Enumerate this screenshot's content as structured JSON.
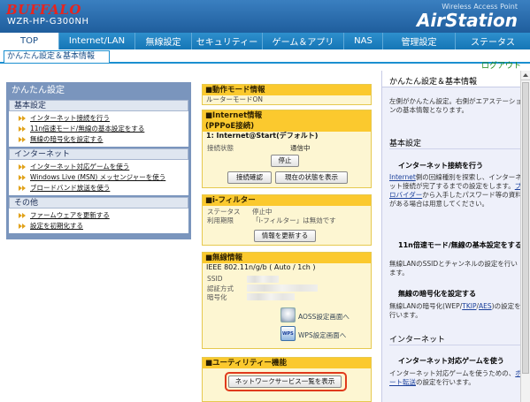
{
  "header": {
    "logo": "BUFFALO",
    "model": "WZR-HP-G300NH",
    "subtitle": "Wireless Access Point",
    "brand": "AirStation"
  },
  "nav": {
    "tabs": [
      {
        "label": "TOP",
        "active": true
      },
      {
        "label": "Internet/LAN",
        "active": false
      },
      {
        "label": "無線設定",
        "active": false
      },
      {
        "label": "セキュリティー",
        "active": false
      },
      {
        "label": "ゲーム＆アプリ",
        "active": false
      },
      {
        "label": "NAS",
        "active": false
      },
      {
        "label": "管理設定",
        "active": false
      },
      {
        "label": "ステータス",
        "active": false
      }
    ],
    "breadcrumb": "かんたん設定＆基本情報",
    "logout": "ログアウト"
  },
  "quick": {
    "title": "かんたん設定",
    "sections": [
      {
        "label": "基本設定",
        "items": [
          "インターネット接続を行う",
          "11n倍速モード/無線の基本設定をする",
          "無線の暗号化を設定する"
        ]
      },
      {
        "label": "インターネット",
        "items": [
          "インターネット対応ゲームを使う",
          "Windows Live (MSN) メッセンジャーを使う",
          "ブロードバンド放送を使う"
        ]
      },
      {
        "label": "その他",
        "items": [
          "ファームウェアを更新する",
          "設定を初期化する"
        ]
      }
    ]
  },
  "status": {
    "mode_title": "■動作モード情報",
    "mode_value": "ルーターモードON",
    "internet_title": "■Internet情報",
    "internet_sub": "(PPPoE接続)",
    "connection_name": "1: Internet@Start(デフォルト)",
    "conn_state_label": "接続状態",
    "conn_state_value": "通信中",
    "stop_button": "停止",
    "check_button": "接続確認",
    "status_button": "現在の状態を表示",
    "filter_title": "■i-フィルター",
    "filter_status_label": "ステータス",
    "filter_status_value": "停止中",
    "filter_period_label": "利用期限",
    "filter_period_value": "「i-フィルター」は無効です",
    "update_button": "情報を更新する",
    "wireless_title": "■無線情報",
    "wireless_mode": "IEEE 802.11n/g/b ( Auto / 1ch )",
    "ssid_label": "SSID",
    "auth_label": "認証方式",
    "enc_label": "暗号化",
    "aoss_link": "AOSS設定画面へ",
    "wps_link": "WPS設定画面へ",
    "utility_title": "■ユーティリティー機能",
    "service_button": "ネットワークサービス一覧を表示"
  },
  "sidebar": {
    "title": "かんたん設定＆基本情報",
    "intro": "左側がかんたん設定。右側がエアステーションの基本情報となります。",
    "section1": "基本設定",
    "item1_title": "インターネット接続を行う",
    "item1_text_a": "Internet",
    "item1_text_b": "側の回線種別を探索し、インターネット接続が完了するまでの設定をします。",
    "item1_text_c": "プロバイダー",
    "item1_text_d": "から入手したパスワード等の資料がある場合は用意してください。",
    "item2_title": "11n倍速モード/無線の基本設定をする",
    "item2_text": "無線LANのSSIDとチャンネルの設定を行います。",
    "item3_title": "無線の暗号化を設定する",
    "item3_text_a": "無線LANの暗号化(WEP/",
    "item3_text_b": "TKIP",
    "item3_text_c": "/",
    "item3_text_d": "AES",
    "item3_text_e": ")の設定を行います。",
    "section2": "インターネット",
    "item4_title": "インターネット対応ゲームを使う",
    "item4_text_a": "インターネット対応ゲームを使うための、",
    "item4_text_b": "ポート転送",
    "item4_text_c": "の設定を行います。"
  }
}
